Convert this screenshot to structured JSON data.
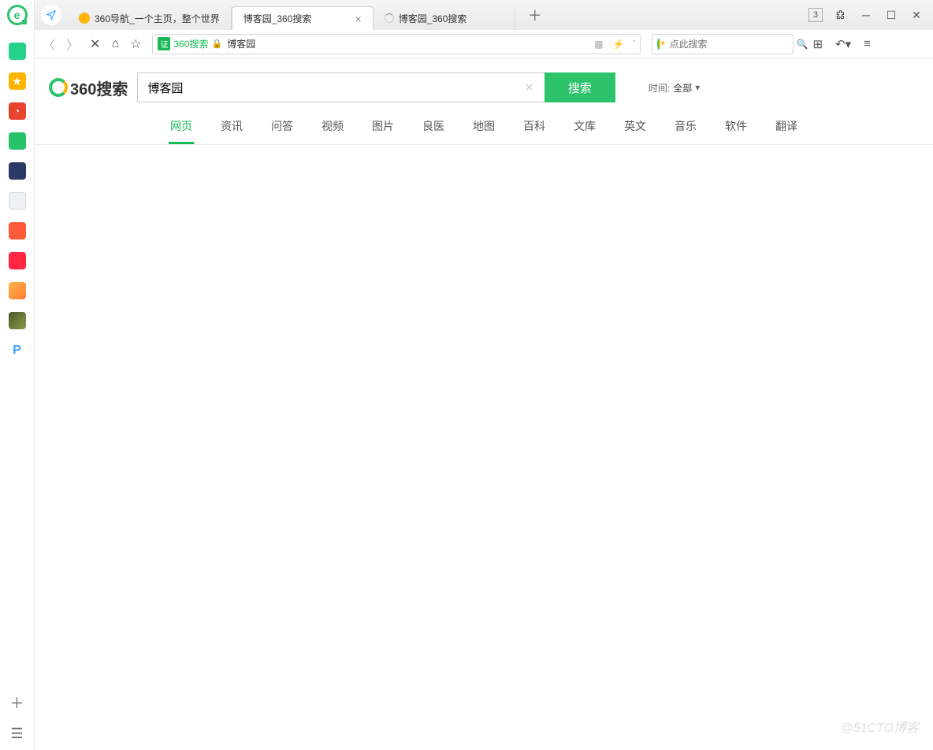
{
  "titlebar": {
    "tabs": [
      {
        "title": "360导航_一个主页，整个世界"
      },
      {
        "title": "博客园_360搜索"
      },
      {
        "title": "博客园_360搜索"
      }
    ],
    "badge": "3"
  },
  "toolbar": {
    "cert_label": "证",
    "cert_text": "360搜索",
    "url_text": "博客园",
    "search_placeholder": "点此搜索"
  },
  "page": {
    "logo_text": "360搜索",
    "search_value": "博客园",
    "search_button": "搜索",
    "time_label": "时间:",
    "time_value": "全部",
    "categories": [
      "网页",
      "资讯",
      "问答",
      "视频",
      "图片",
      "良医",
      "地图",
      "百科",
      "文库",
      "英文",
      "音乐",
      "软件",
      "翻译"
    ]
  },
  "watermark": "@51CTO博客",
  "colors": {
    "green": "#2cc36b",
    "yellow": "#ffb400",
    "red_star": "#ff9800"
  }
}
